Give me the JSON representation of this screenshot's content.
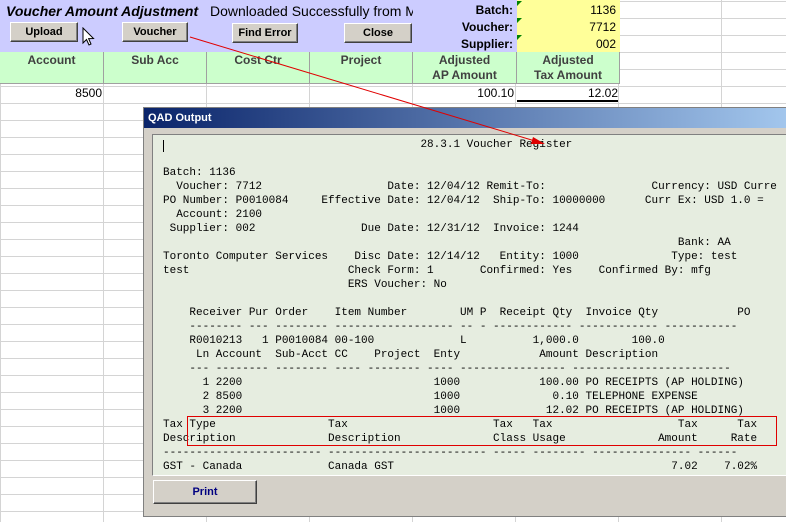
{
  "sheet": {
    "title": "Voucher Amount Adjustment",
    "status": "Downloaded Successfully from MFG",
    "buttons": {
      "upload": "Upload",
      "voucher": "Voucher",
      "find_error": "Find Error",
      "close": "Close"
    },
    "meta_labels": {
      "batch": "Batch:",
      "voucher": "Voucher:",
      "supplier": "Supplier:"
    },
    "meta_values": {
      "batch": "1136",
      "voucher": "7712",
      "supplier": "002"
    },
    "columns": [
      "Account",
      "Sub Acc",
      "Cost Ctr",
      "Project",
      "Adjusted\nAP Amount",
      "Adjusted\nTax Amount"
    ],
    "row": {
      "account": "8500",
      "ap_amount": "100.10",
      "tax_amount": "12.02"
    }
  },
  "qad": {
    "window_title": "QAD Output",
    "print_label": "Print",
    "report_lines": [
      "                                       28.3.1 Voucher Register",
      "",
      "Batch: 1136",
      "  Voucher: 7712                   Date: 12/04/12 Remit-To:                Currency: USD Curre",
      "PO Number: P0010084     Effective Date: 12/04/12  Ship-To: 10000000      Curr Ex: USD 1.0 =",
      "  Account: 2100",
      " Supplier: 002                Due Date: 12/31/12  Invoice: 1244",
      "                                                                              Bank: AA",
      "Toronto Computer Services    Disc Date: 12/14/12   Entity: 1000              Type: test",
      "test                        Check Form: 1       Confirmed: Yes    Confirmed By: mfg",
      "                            ERS Voucher: No",
      "",
      "    Receiver Pur Order    Item Number        UM P  Receipt Qty  Invoice Qty            PO",
      "    -------- --- -------- ------------------ -- - ------------ ------------ -----------",
      "    R0010213   1 P0010084 00-100             L          1,000.0        100.0",
      "     Ln Account  Sub-Acct CC    Project  Enty            Amount Description",
      "    --- -------- -------- ---- -------- ---- ---------------- ------------------------",
      "      1 2200                             1000            100.00 PO RECEIPTS (AP HOLDING)",
      "      2 8500                             1000              0.10 TELEPHONE EXPENSE",
      "      3 2200                             1000             12.02 PO RECEIPTS (AP HOLDING)",
      "Tax Type                 Tax                      Tax   Tax                   Tax      Tax",
      "Description              Description              Class Usage              Amount     Rate",
      "------------------------ ------------------------ ----- -------- --------------- ------",
      "GST - Canada             Canada GST                                          7.02    7.02%"
    ]
  }
}
